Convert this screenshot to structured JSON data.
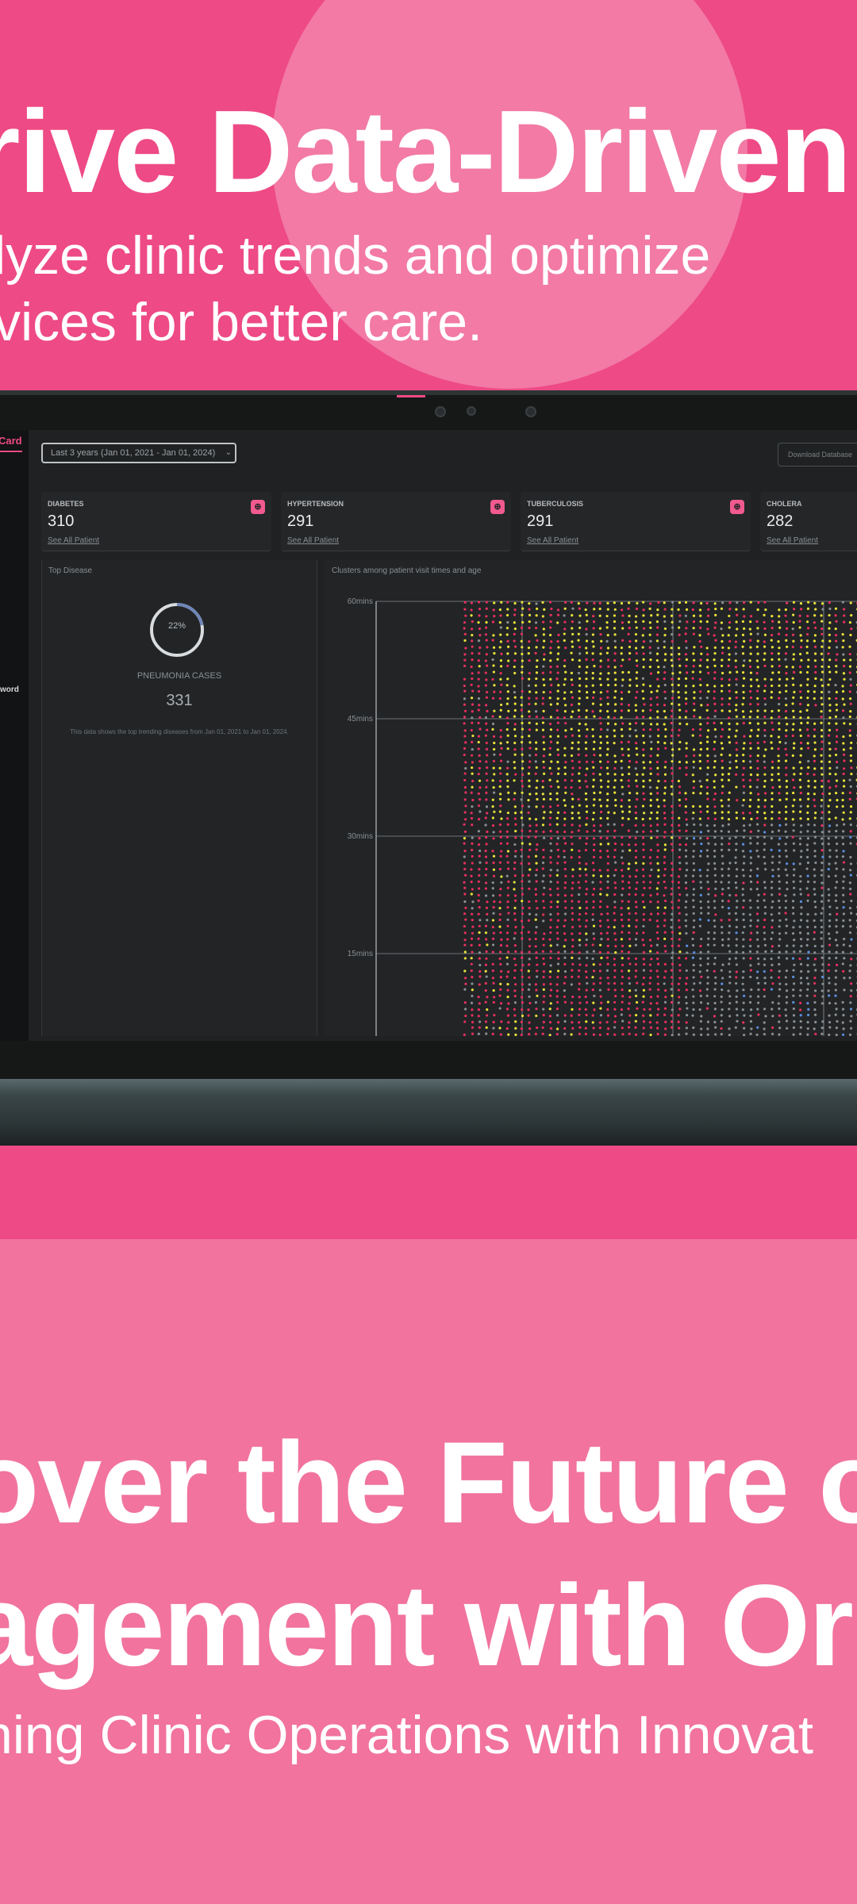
{
  "hero": {
    "title": "rive Data-Driven",
    "subtitle_line1": "lyze clinic trends and optimize",
    "subtitle_line2": "vices for better care."
  },
  "dashboard": {
    "sidebar": {
      "card_label": "Card",
      "item_label": "word"
    },
    "date_filter": {
      "value": "Last 3 years (Jan 01, 2021 - Jan 01, 2024)"
    },
    "download_button": "Download Database",
    "stats": [
      {
        "name": "DIABETES",
        "value": "310",
        "link": "See All Patient"
      },
      {
        "name": "HYPERTENSION",
        "value": "291",
        "link": "See All Patient"
      },
      {
        "name": "TUBERCULOSIS",
        "value": "291",
        "link": "See All Patient"
      },
      {
        "name": "CHOLERA",
        "value": "282",
        "link": "See All Patient"
      }
    ],
    "top_disease": {
      "title": "Top Disease",
      "percent": "22%",
      "percent_value": 0.22,
      "cases_label": "PNEUMONIA CASES",
      "cases_value": "331",
      "note": "This data shows the top trending diseases from Jan 01, 2021 to Jan 01, 2024."
    },
    "clusters_chart": {
      "title": "Clusters among patient visit times and age",
      "chart_data": {
        "type": "scatter",
        "title": "Clusters among patient visit times and age",
        "y_ticks": [
          "60mins",
          "45mins",
          "30mins",
          "15mins"
        ],
        "ylim": [
          10,
          60
        ],
        "grid": true,
        "colors": {
          "yellow": "#e8e23a",
          "red": "#e5305e",
          "gray": "#8a8f92",
          "blue": "#5b8fe0"
        }
      }
    }
  },
  "bottom": {
    "title_line1": "over the Future o",
    "title_line2": "agement with Or",
    "subtitle": "ning Clinic Operations with Innovat"
  }
}
